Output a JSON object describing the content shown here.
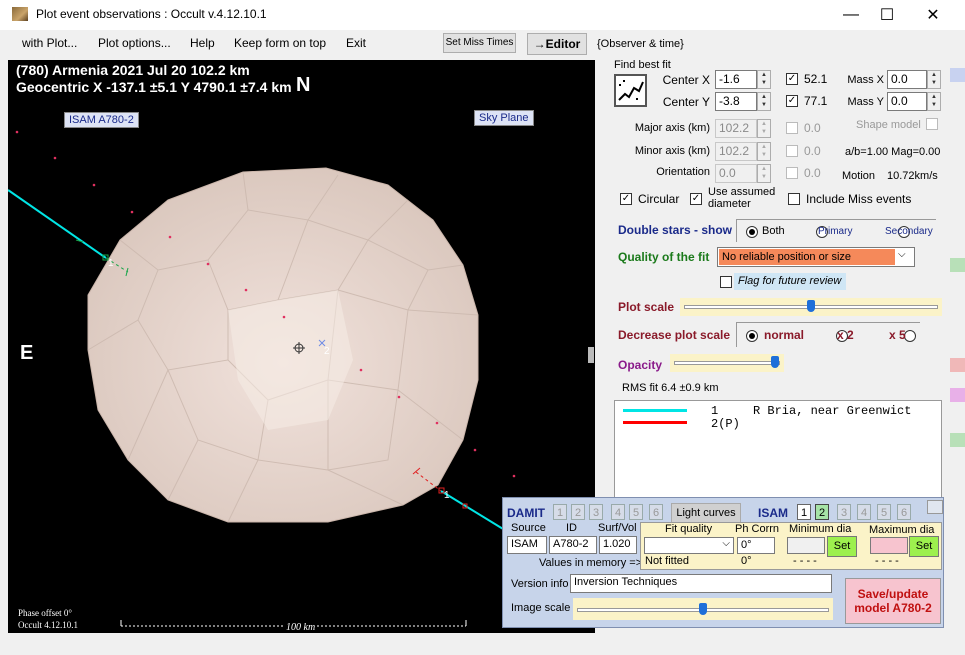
{
  "window": {
    "title": "Plot event observations : Occult v.4.12.10.1",
    "minimize": "—",
    "maximize": "☐",
    "close": "✕"
  },
  "menu": {
    "items": [
      "with Plot...",
      "Plot options...",
      "Help",
      "Keep form on top",
      "Exit"
    ],
    "set_miss_times": "Set Miss Times",
    "editor": "→Editor",
    "observer_time": "{Observer & time}"
  },
  "plot": {
    "line1": "(780) Armenia  2021 Jul 20   102.2 km",
    "line2": "Geocentric  X  -137.1 ±5.1  Y 4790.1 ±7.4 km",
    "north": "N",
    "east": "E",
    "model_label": "ISAM A780-2",
    "sky_plane": "Sky Plane",
    "chord_label_1a": "1",
    "chord_label_1b": "1",
    "center_label": "2",
    "phase_offset": "Phase offset 0°",
    "version": "Occult 4.12.10.1",
    "scale_label": "100 km"
  },
  "fit": {
    "find_best_fit": "Find best fit",
    "center_x_label": "Center X",
    "center_x": "-1.6",
    "center_x_chk": "52.1",
    "center_y_label": "Center Y",
    "center_y": "-3.8",
    "center_y_chk": "77.1",
    "mass_x_label": "Mass X",
    "mass_x": "0.0",
    "mass_y_label": "Mass Y",
    "mass_y": "0.0",
    "major_label": "Major axis (km)",
    "major": "102.2",
    "major_chk": "0.0",
    "minor_label": "Minor axis (km)",
    "minor": "102.2",
    "minor_chk": "0.0",
    "orient_label": "Orientation",
    "orient": "0.0",
    "orient_chk": "0.0",
    "shape_model": "Shape model",
    "ab_mag": "a/b=1.00  Mag=0.00",
    "motion_label": "Motion",
    "motion": "10.72km/s",
    "circular": "Circular",
    "use_assumed": "Use assumed diameter",
    "include_miss": "Include Miss events"
  },
  "double_stars": {
    "title": "Double stars - show",
    "both": "Both",
    "primary": "Primary",
    "secondary": "Secondary"
  },
  "quality": {
    "title": "Quality of the fit",
    "value": "No reliable position or size",
    "flag": "Flag for future review"
  },
  "plot_scale": {
    "title": "Plot scale",
    "level": 0.5
  },
  "decrease": {
    "title": "Decrease plot scale",
    "normal": "normal",
    "x2": "x 2",
    "x5": "x 5"
  },
  "opacity": {
    "title": "Opacity",
    "level": 0.95
  },
  "rms": "RMS fit 6.4 ±0.9 km",
  "legend": {
    "row1_num": "1",
    "row1_text": "R Bria, near Greenwict",
    "row2": "2(P)"
  },
  "damit": {
    "damit": "DAMIT",
    "damit_nums": [
      "1",
      "2",
      "3",
      "4",
      "5",
      "6"
    ],
    "light_curves": "Light curves",
    "isam": "ISAM",
    "isam_nums": [
      "1",
      "2",
      "3",
      "4",
      "5",
      "6"
    ],
    "source_h": "Source",
    "id_h": "ID",
    "surf_h": "Surf/Vol",
    "source": "ISAM",
    "id": "A780-2",
    "surf": "1.020",
    "values_mem": "Values in memory =>",
    "fit_quality_h": "Fit quality",
    "ph_corr_h": "Ph Corrn",
    "min_dia_h": "Minimum dia",
    "max_dia_h": "Maximum dia",
    "ph_corr": "0°",
    "not_fitted": "Not fitted",
    "ph_mem": "0°",
    "dash1": "- - - -",
    "dash2": "- - - -",
    "set": "Set",
    "version_label": "Version info",
    "version": "Inversion Techniques",
    "image_scale": "Image scale",
    "image_scale_level": 0.5,
    "save": "Save/update model A780-2"
  },
  "colors": {
    "chord1": "#00e5e5",
    "chord2": "#ff0000",
    "asteroid": "#e8d8d0",
    "quality_bg": "#f5895a"
  }
}
